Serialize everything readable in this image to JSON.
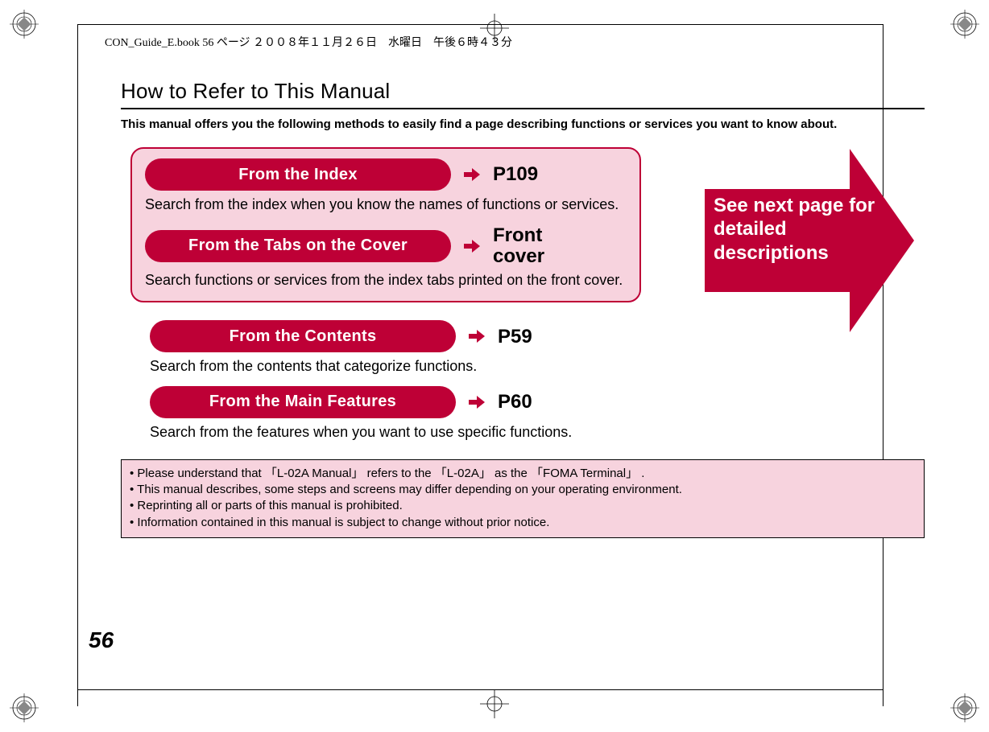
{
  "header_line": "CON_Guide_E.book  56 ページ  ２００８年１１月２６日　水曜日　午後６時４３分",
  "section_title": "How to Refer to This Manual",
  "intro": "This manual offers you the following methods to easily find a page describing functions or services you want to know about.",
  "methods": {
    "index": {
      "pill": "From the Index",
      "ref": "P109",
      "desc": "Search from the index when you know the names of functions or services."
    },
    "tabs": {
      "pill": "From the Tabs on the Cover",
      "ref": "Front\ncover",
      "desc": "Search functions or services from the index tabs printed on the front cover."
    },
    "contents": {
      "pill": "From the Contents",
      "ref": "P59",
      "desc": "Search from the contents that categorize functions."
    },
    "features": {
      "pill": "From the Main Features",
      "ref": "P60",
      "desc": "Search from the features when you want to use specific functions."
    }
  },
  "big_arrow_text": "See next page for detailed descriptions",
  "notes": [
    "Please understand that 「L-02A Manual」 refers to the 「L-02A」 as the 「FOMA Terminal」 .",
    "This manual describes, some steps and screens may differ depending on your operating environment.",
    "Reprinting all or parts of this manual is prohibited.",
    "Information contained in this manual is subject to change without prior notice."
  ],
  "page_number": "56"
}
